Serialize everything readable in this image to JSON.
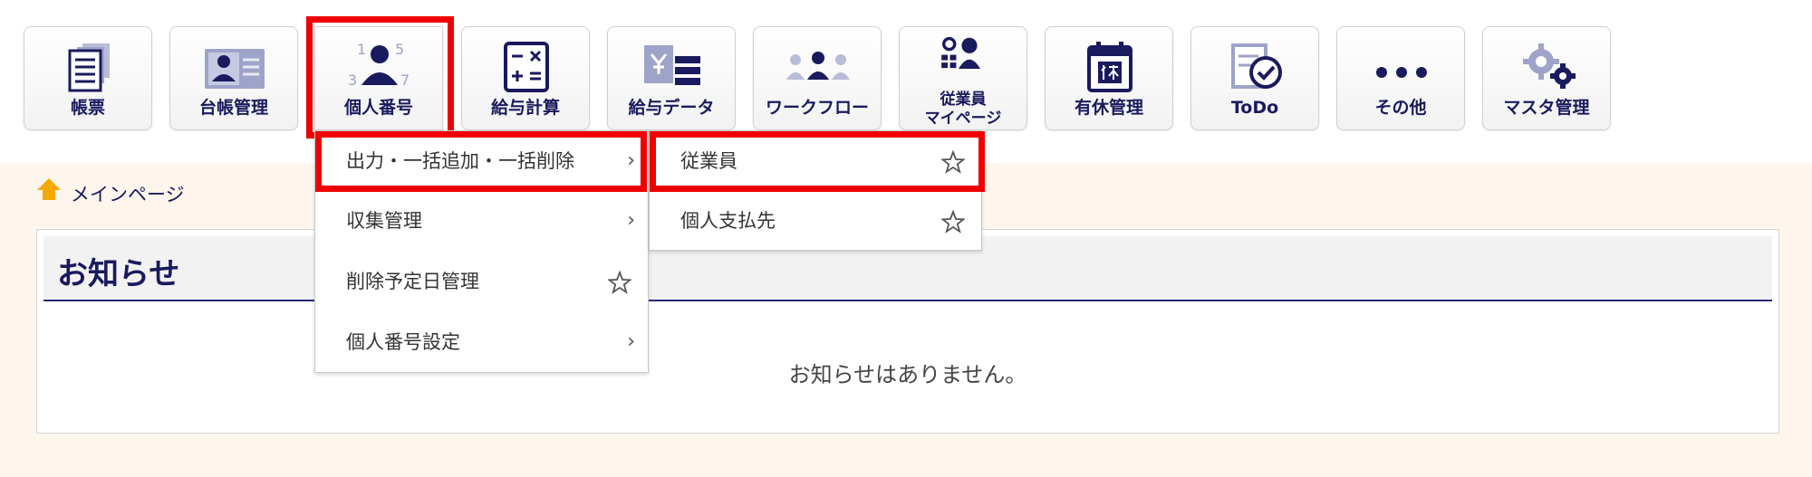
{
  "nav": {
    "tiles": [
      {
        "label": "帳票",
        "icon": "report-icon"
      },
      {
        "label": "台帳管理",
        "icon": "ledger-icon"
      },
      {
        "label": "個人番号",
        "icon": "personal-number-icon"
      },
      {
        "label": "給与計算",
        "icon": "calculator-icon"
      },
      {
        "label": "給与データ",
        "icon": "payroll-data-icon"
      },
      {
        "label": "ワークフロー",
        "icon": "workflow-icon"
      },
      {
        "label_line1": "従業員",
        "label_line2": "マイページ",
        "icon": "employee-mypage-icon"
      },
      {
        "label": "有休管理",
        "icon": "calendar-icon"
      },
      {
        "label": "ToDo",
        "icon": "todo-check-icon"
      },
      {
        "label": "その他",
        "icon": "more-dots-icon"
      },
      {
        "label": "マスタ管理",
        "icon": "gear-icon"
      }
    ],
    "active_tile": "個人番号"
  },
  "personal_number_icon_digits": {
    "d1": "1",
    "d2": "5",
    "d3": "3",
    "d4": "7"
  },
  "dropdown": {
    "items": [
      {
        "label": "出力・一括追加・一括削除",
        "has_submenu": true,
        "highlighted": true
      },
      {
        "label": "収集管理",
        "has_submenu": true
      },
      {
        "label": "削除予定日管理",
        "has_favorite": true
      },
      {
        "label": "個人番号設定",
        "has_submenu": true
      }
    ]
  },
  "submenu": {
    "items": [
      {
        "label": "従業員",
        "has_favorite": true,
        "highlighted": true
      },
      {
        "label": "個人支払先",
        "has_favorite": true
      }
    ]
  },
  "breadcrumb": {
    "label": "メインページ"
  },
  "notice": {
    "title": "お知らせ",
    "empty_message": "お知らせはありません。"
  },
  "colors": {
    "navy": "#1a1a5e",
    "highlight_red": "#ef0000",
    "content_bg": "#fef6ec",
    "home_icon": "#f5a800"
  },
  "submenu_chevron": "›"
}
